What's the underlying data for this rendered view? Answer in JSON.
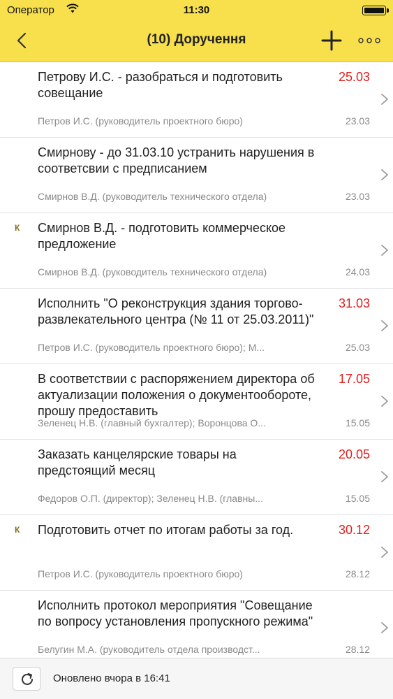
{
  "status_bar": {
    "carrier": "Оператор",
    "time": "11:30"
  },
  "nav": {
    "title": "(10) Доручення"
  },
  "items": [
    {
      "title": "Петрову И.С. - разобраться и подготовить совещание",
      "due": "25.03",
      "subtitle": "Петров И.С. (руководитель проектного бюро)",
      "date": "23.03",
      "marker": ""
    },
    {
      "title": "Смирнову - до 31.03.10 устранить нарушения в соответсвии с предписанием",
      "due": "",
      "subtitle": "Смирнов В.Д. (руководитель технического отдела)",
      "date": "23.03",
      "marker": ""
    },
    {
      "title": "Смирнов В.Д. - подготовить коммерческое предложение",
      "due": "",
      "subtitle": "Смирнов В.Д. (руководитель технического отдела)",
      "date": "24.03",
      "marker": "К"
    },
    {
      "title": "Исполнить \"О реконструкция здания торгово-развлекательного центра (№ 11 от 25.03.2011)\"",
      "due": "31.03",
      "subtitle": "Петров И.С. (руководитель проектного бюро); М...",
      "date": "25.03",
      "marker": ""
    },
    {
      "title": "В соответствии с распоряжением директора об актуализации положения о документообороте, прошу предоставить",
      "due": "17.05",
      "subtitle": "Зеленец Н.В. (главный бухгалтер); Воронцова О...",
      "date": "15.05",
      "marker": ""
    },
    {
      "title": "Заказать канцелярские товары на предстоящий месяц",
      "due": "20.05",
      "subtitle": "Федоров О.П. (директор); Зеленец Н.В. (главны...",
      "date": "15.05",
      "marker": ""
    },
    {
      "title": "Подготовить отчет по итогам работы за год.",
      "due": "30.12",
      "subtitle": "Петров И.С. (руководитель проектного бюро)",
      "date": "28.12",
      "marker": "К"
    },
    {
      "title": "Исполнить протокол мероприятия \"Совещание по вопросу установления пропускного режима\"",
      "due": "",
      "subtitle": "Белугин М.А. (руководитель отдела производст...",
      "date": "28.12",
      "marker": ""
    }
  ],
  "footer": {
    "updated": "Оновлено вчора в 16:41"
  },
  "colors": {
    "accent": "#f7e04b",
    "overdue": "#e02020",
    "secondary_text": "#8a8a8a"
  },
  "icons": {
    "back": "chevron-left-icon",
    "add": "plus-icon",
    "more": "ellipsis-icon",
    "row": "chevron-right-icon",
    "refresh": "refresh-icon",
    "wifi": "wifi-icon",
    "battery": "battery-icon"
  }
}
